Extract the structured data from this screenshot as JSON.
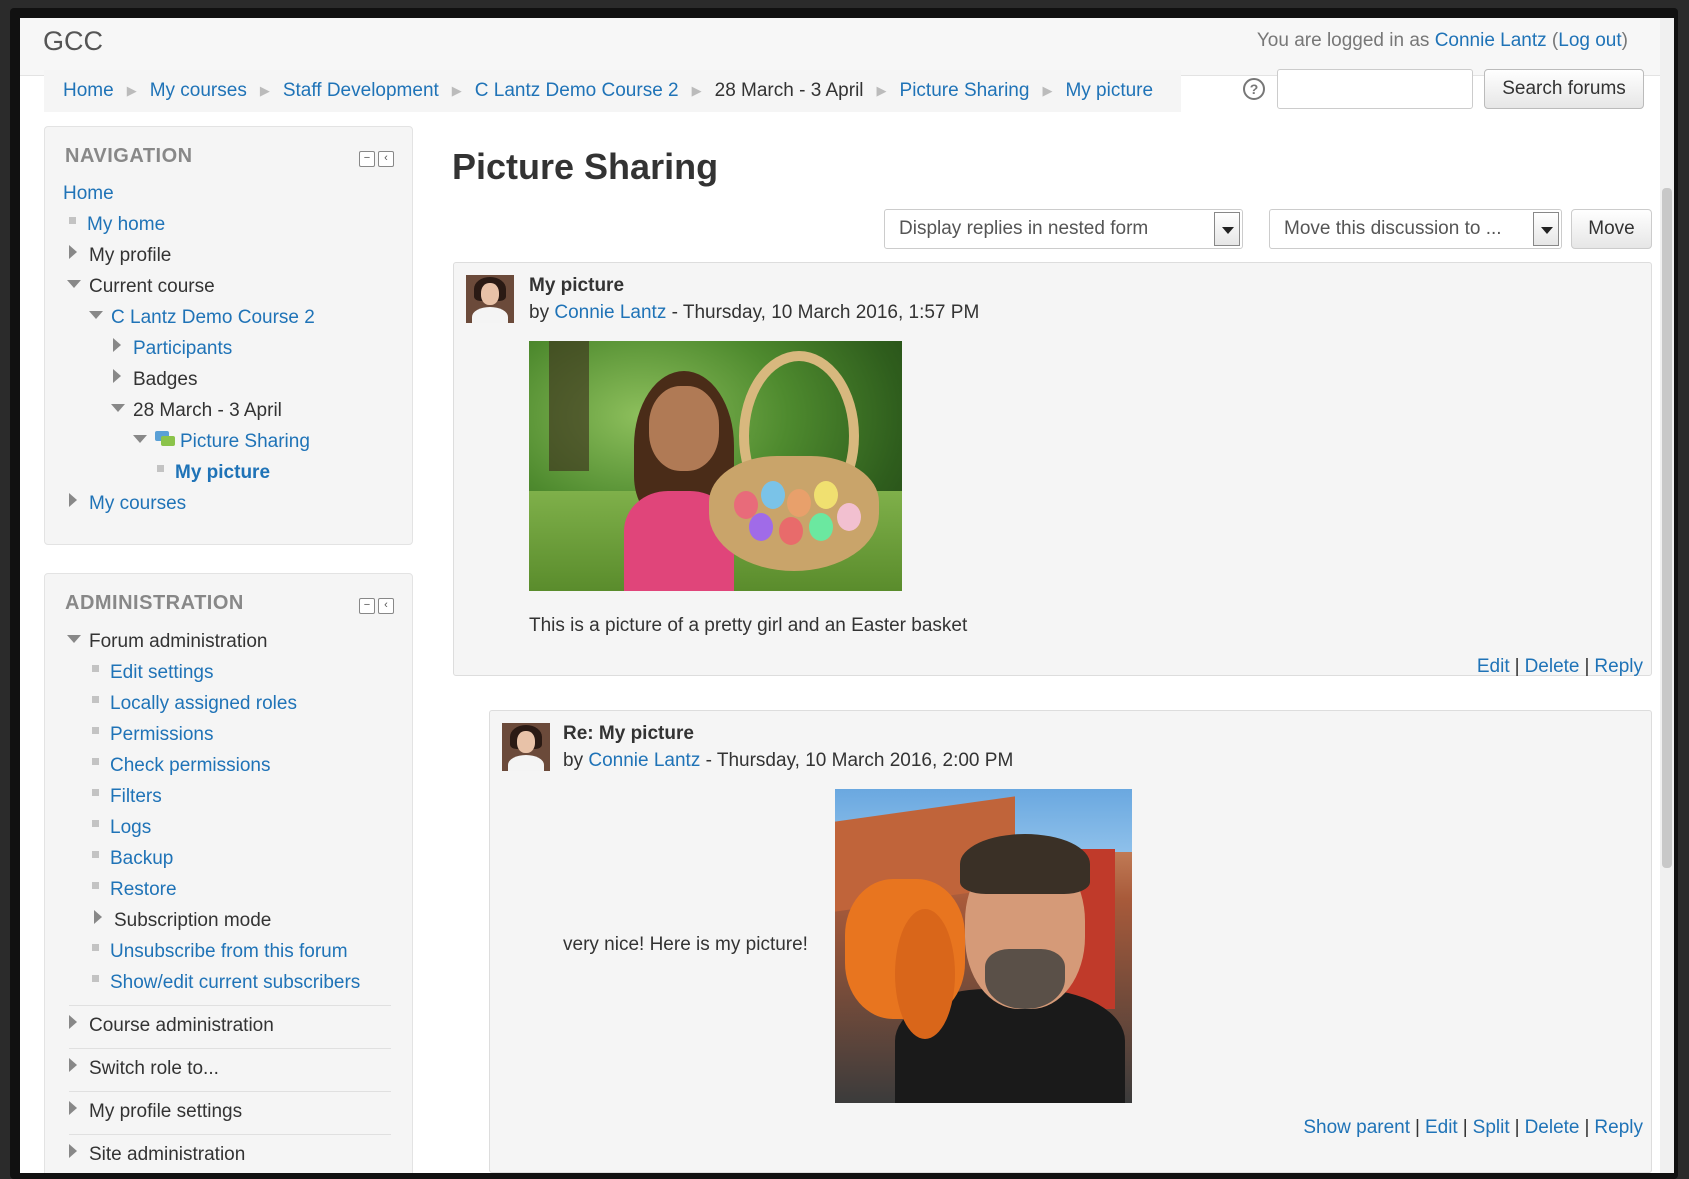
{
  "header": {
    "site_name": "GCC",
    "login_prefix": "You are logged in as ",
    "user_name": "Connie Lantz",
    "logout_label": "Log out"
  },
  "breadcrumb": {
    "items": [
      "Home",
      "My courses",
      "Staff Development",
      "C Lantz Demo Course 2",
      "28 March - 3 April",
      "Picture Sharing",
      "My picture"
    ],
    "separator": "▶"
  },
  "search": {
    "help_glyph": "?",
    "placeholder": "",
    "button_label": "Search forums"
  },
  "navigation": {
    "title": "NAVIGATION",
    "items": {
      "home": "Home",
      "my_home": "My home",
      "my_profile": "My profile",
      "current_course": "Current course",
      "course": "C Lantz Demo Course 2",
      "participants": "Participants",
      "badges": "Badges",
      "week": "28 March - 3 April",
      "forum": "Picture Sharing",
      "discussion": "My picture",
      "my_courses": "My courses"
    }
  },
  "administration": {
    "title": "ADMINISTRATION",
    "items": {
      "forum_admin": "Forum administration",
      "edit_settings": "Edit settings",
      "local_roles": "Locally assigned roles",
      "permissions": "Permissions",
      "check_permissions": "Check permissions",
      "filters": "Filters",
      "logs": "Logs",
      "backup": "Backup",
      "restore": "Restore",
      "subscription_mode": "Subscription mode",
      "unsubscribe": "Unsubscribe from this forum",
      "subscribers": "Show/edit current subscribers",
      "course_admin": "Course administration",
      "switch_role": "Switch role to...",
      "profile_settings": "My profile settings",
      "site_admin": "Site administration"
    }
  },
  "main": {
    "title": "Picture Sharing",
    "display_mode": "Display replies in nested form",
    "move_select": "Move this discussion to ...",
    "move_button": "Move"
  },
  "posts": [
    {
      "subject": "My picture",
      "by": "by ",
      "author": "Connie Lantz",
      "date": " - Thursday, 10 March 2016, 1:57 PM",
      "text": "This is a picture of a pretty girl and an Easter basket",
      "commands": [
        "Edit",
        "Delete",
        "Reply"
      ]
    },
    {
      "subject": "Re: My picture",
      "by": "by ",
      "author": "Connie Lantz",
      "date": " - Thursday, 10 March 2016, 2:00 PM",
      "text": "very nice! Here is my picture!",
      "commands": [
        "Show parent",
        "Edit",
        "Split",
        "Delete",
        "Reply"
      ]
    }
  ],
  "colors": {
    "link": "#1f73b7",
    "block_bg": "#f5f5f5",
    "post_bg": "#f5f5f5"
  }
}
